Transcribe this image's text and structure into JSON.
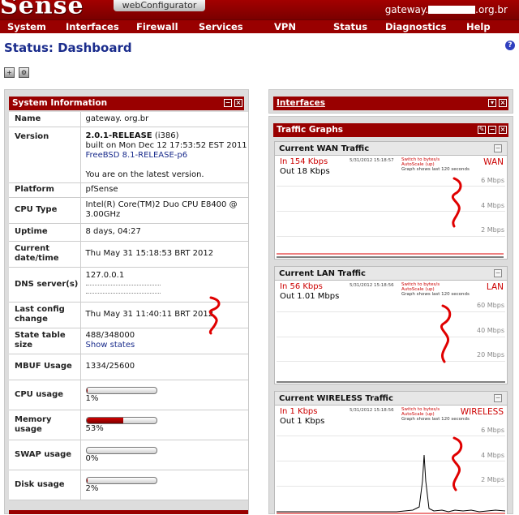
{
  "header": {
    "logo": "Sense",
    "subtitle": "webConfigurator",
    "hostname_prefix": "gateway.",
    "hostname_suffix": ".org.br"
  },
  "nav": [
    "System",
    "Interfaces",
    "Firewall",
    "Services",
    "VPN",
    "Status",
    "Diagnostics",
    "Help"
  ],
  "page": {
    "title": "Status: Dashboard"
  },
  "system_info": {
    "title": "System Information",
    "name": {
      "label": "Name",
      "value": "gateway.                    org.br"
    },
    "version": {
      "label": "Version",
      "release": "2.0.1-RELEASE",
      "arch": " (i386)",
      "built": "built on Mon Dec 12 17:53:52 EST 2011",
      "freebsd": "FreeBSD 8.1-RELEASE-p6",
      "status": "You are on the latest version."
    },
    "platform": {
      "label": "Platform",
      "value": "pfSense"
    },
    "cpu_type": {
      "label": "CPU Type",
      "value": "Intel(R) Core(TM)2 Duo CPU E8400 @ 3.00GHz"
    },
    "uptime": {
      "label": "Uptime",
      "value": "8 days, 04:27"
    },
    "current_datetime": {
      "label": "Current date/time",
      "value": "Thu May 31 15:18:53 BRT 2012"
    },
    "dns": {
      "label": "DNS server(s)",
      "value": "127.0.0.1"
    },
    "last_config": {
      "label": "Last config change",
      "value": "Thu May 31 11:40:11 BRT 2012"
    },
    "state_table": {
      "label": "State table size",
      "value": "488/348000",
      "link": "Show states"
    },
    "mbuf": {
      "label": "MBUF Usage",
      "value": "1334/25600"
    },
    "cpu_usage": {
      "label": "CPU usage",
      "percent_text": "1%",
      "fraction": 0.01
    },
    "memory_usage": {
      "label": "Memory usage",
      "percent_text": "53%",
      "fraction": 0.53
    },
    "swap_usage": {
      "label": "SWAP usage",
      "percent_text": "0%",
      "fraction": 0.0
    },
    "disk_usage": {
      "label": "Disk usage",
      "percent_text": "2%",
      "fraction": 0.02
    }
  },
  "interfaces_panel": {
    "title": "Interfaces"
  },
  "traffic_graphs": {
    "title": "Traffic Graphs",
    "date_stamp": "5/31/2012 15:18:57",
    "date_stamp_lan": "5/31/2012 15:18:56",
    "date_stamp_wireless": "5/31/2012 15:18:56",
    "switch_text": "Switch to bytes/s",
    "autoscale_text": "AutoScale (up)",
    "note": "Graph shows last 120 seconds",
    "wan": {
      "heading": "Current WAN Traffic",
      "in": "In   154 Kbps",
      "out": "Out 18 Kbps",
      "iface": "WAN",
      "ticks": [
        "6 Mbps",
        "4 Mbps",
        "2 Mbps"
      ]
    },
    "lan": {
      "heading": "Current LAN Traffic",
      "in": "In   56 Kbps",
      "out": "Out 1.01 Mbps",
      "iface": "LAN",
      "ticks": [
        "60 Mbps",
        "40 Mbps",
        "20 Mbps"
      ]
    },
    "wireless": {
      "heading": "Current WIRELESS Traffic",
      "in": "In   1 Kbps",
      "out": "Out 1 Kbps",
      "iface": "WIRELESS",
      "ticks": [
        "6 Mbps",
        "4 Mbps",
        "2 Mbps"
      ]
    }
  },
  "colors": {
    "brand_red": "#990000",
    "title_blue": "#1a2c8c",
    "annotation_red": "#e00000"
  }
}
